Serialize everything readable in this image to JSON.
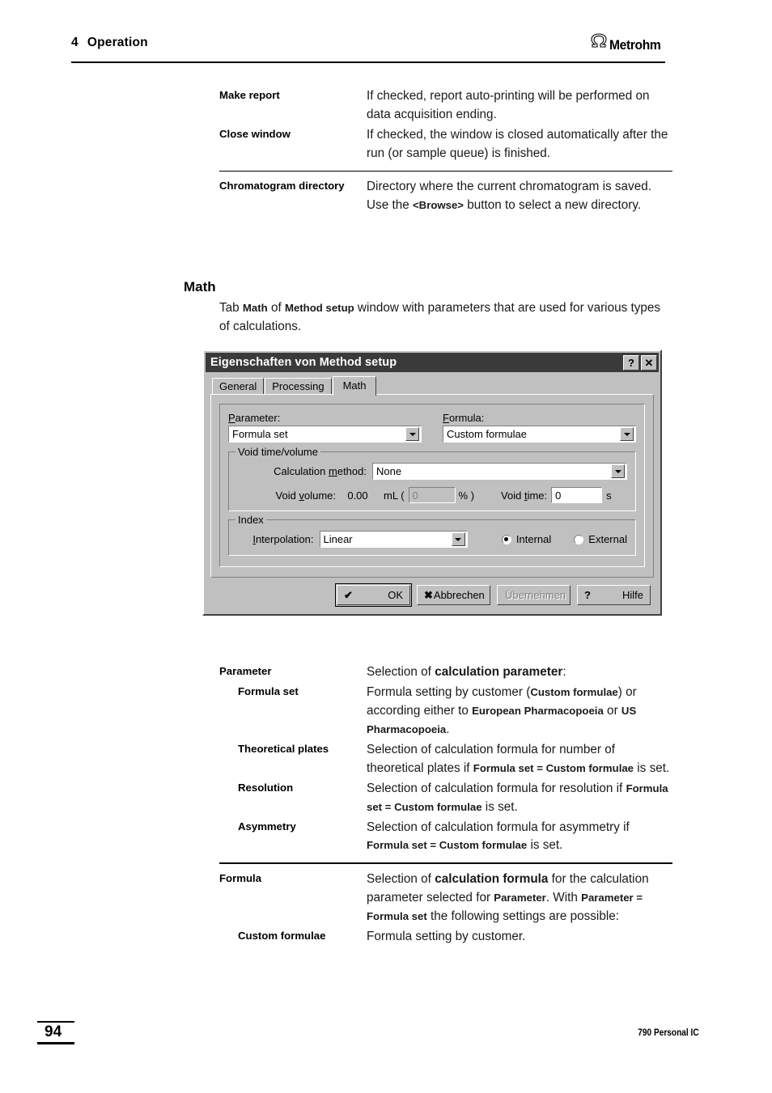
{
  "header": {
    "chapter_number": "4",
    "chapter_title": "Operation",
    "brand": "Metrohm",
    "brand_mark_icon": "metrohm-omega-icon"
  },
  "top_defs": {
    "group1": [
      {
        "term": "Make report",
        "desc": "If checked, report auto-printing will be performed on data acquisition ending."
      },
      {
        "term": "Close window",
        "desc": "If checked, the window is closed automatically after the run (or sample queue) is finished."
      }
    ],
    "group2": [
      {
        "term": "Chromatogram directory",
        "desc_part1": "Directory where the current chromatogram is saved. Use the ",
        "desc_bold": "<Browse>",
        "desc_part2": " button to select a new directory."
      }
    ]
  },
  "section": {
    "heading": "Math",
    "intro_part1": "Tab ",
    "intro_bold1": "Math",
    "intro_part2": " of ",
    "intro_bold2": "Method setup",
    "intro_part3": " window with parameters that are used for various types of calculations."
  },
  "dialog": {
    "title": "Eigenschaften von Method setup",
    "help_button": "?",
    "close_button": "✕",
    "tabs": [
      {
        "label": "General",
        "active": false
      },
      {
        "label": "Processing",
        "active": false
      },
      {
        "label": "Math",
        "active": true
      }
    ],
    "parameter": {
      "label_u": "P",
      "label_rest": "arameter:",
      "value": "Formula set"
    },
    "formula": {
      "label_u": "F",
      "label_rest": "ormula:",
      "value": "Custom formulae"
    },
    "void_group": {
      "legend": "Void time/volume",
      "calc_method_label_pre": "Calculation ",
      "calc_method_label_u": "m",
      "calc_method_label_post": "ethod:",
      "calc_method_value": "None",
      "void_volume_label_pre": "Void ",
      "void_volume_label_u": "v",
      "void_volume_label_post": "olume:",
      "void_volume_value": "0.00",
      "void_volume_unit": "mL (",
      "void_percent_value": "0",
      "void_percent_unit": "% )",
      "void_time_label_pre": "Void ",
      "void_time_label_u": "t",
      "void_time_label_post": "ime:",
      "void_time_value": "0",
      "void_time_unit": "s"
    },
    "index_group": {
      "legend": "Index",
      "interpolation_label_u": "I",
      "interpolation_label_rest": "nterpolation:",
      "interpolation_value": "Linear",
      "radio_internal": "Internal",
      "radio_external": "External",
      "radio_selected": "Internal"
    },
    "buttons": [
      {
        "glyph": "✔",
        "label": "OK",
        "state": "default"
      },
      {
        "glyph": "✖",
        "label": "Abbrechen",
        "state": "normal"
      },
      {
        "glyph": "",
        "label": "Übernehmen",
        "state": "disabled"
      },
      {
        "glyph": "?",
        "label": "Hilfe",
        "state": "normal"
      }
    ]
  },
  "bottom_defs": {
    "group1": [
      {
        "term": "Parameter",
        "indent": 0,
        "parts": [
          {
            "t": "Selection of ",
            "b": false
          },
          {
            "t": "calculation parameter",
            "b": true,
            "big": true
          },
          {
            "t": ":",
            "b": false
          }
        ]
      },
      {
        "term": "Formula set",
        "indent": 1,
        "parts": [
          {
            "t": "Formula setting by customer (",
            "b": false
          },
          {
            "t": "Custom formulae",
            "b": true
          },
          {
            "t": ") or according either to ",
            "b": false
          },
          {
            "t": "European Pharmacopoeia",
            "b": true
          },
          {
            "t": " or ",
            "b": false
          },
          {
            "t": "US Pharmacopoeia",
            "b": true
          },
          {
            "t": ".",
            "b": false
          }
        ]
      },
      {
        "term": "Theoretical plates",
        "indent": 1,
        "parts": [
          {
            "t": "Selection of calculation formula for number of theoretical plates if ",
            "b": false
          },
          {
            "t": "Formula set",
            "b": true
          },
          {
            "t": " = ",
            "b": true
          },
          {
            "t": "Custom formulae",
            "b": true
          },
          {
            "t": " is set.",
            "b": false
          }
        ]
      },
      {
        "term": "Resolution",
        "indent": 1,
        "parts": [
          {
            "t": "Selection of calculation formula for resolution if ",
            "b": false
          },
          {
            "t": "Formula set",
            "b": true
          },
          {
            "t": " = ",
            "b": true
          },
          {
            "t": "Custom formulae",
            "b": true
          },
          {
            "t": " is set.",
            "b": false
          }
        ]
      },
      {
        "term": "Asymmetry",
        "indent": 1,
        "parts": [
          {
            "t": "Selection of calculation formula for asymmetry if ",
            "b": false
          },
          {
            "t": "Formula set",
            "b": true
          },
          {
            "t": " = ",
            "b": true
          },
          {
            "t": "Custom formulae",
            "b": true
          },
          {
            "t": " is set.",
            "b": false
          }
        ]
      }
    ],
    "group2": [
      {
        "term": "Formula",
        "indent": 0,
        "parts": [
          {
            "t": "Selection of ",
            "b": false
          },
          {
            "t": "calculation formula",
            "b": true,
            "big": true
          },
          {
            "t": " for the calculation parameter selected for ",
            "b": false
          },
          {
            "t": "Parameter",
            "b": true
          },
          {
            "t": ". With ",
            "b": false
          },
          {
            "t": "Parameter = Formula set",
            "b": true
          },
          {
            "t": " the following settings are possible:",
            "b": false
          }
        ]
      },
      {
        "term": "Custom formulae",
        "indent": 1,
        "parts": [
          {
            "t": "Formula setting by customer.",
            "b": false
          }
        ]
      }
    ]
  },
  "footer": {
    "page_number": "94",
    "product": "790 Personal IC"
  }
}
